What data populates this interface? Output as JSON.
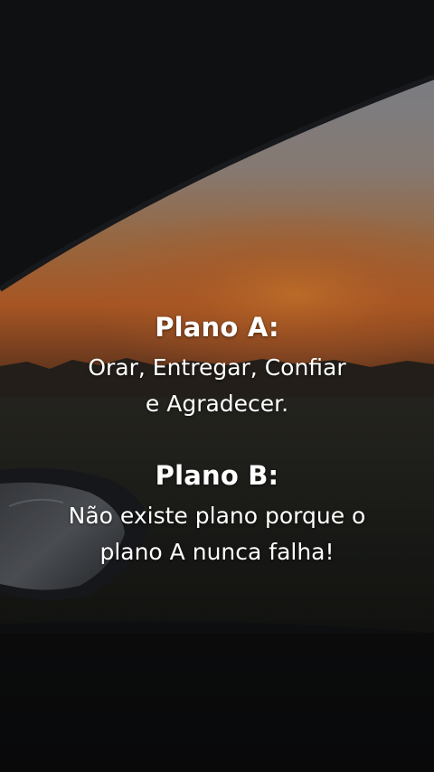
{
  "overlay": {
    "plan_a": {
      "title": "Plano A:",
      "line1": "Orar, Entregar, Confiar",
      "line2": "e Agradecer."
    },
    "plan_b": {
      "title": "Plano B:",
      "line1": "Não existe plano porque o",
      "line2": "plano A nunca falha!"
    }
  },
  "colors": {
    "text": "#ffffff",
    "sky_top": "#8a8e95",
    "sunset_glow": "#c96a2a",
    "car_interior": "#121417"
  }
}
